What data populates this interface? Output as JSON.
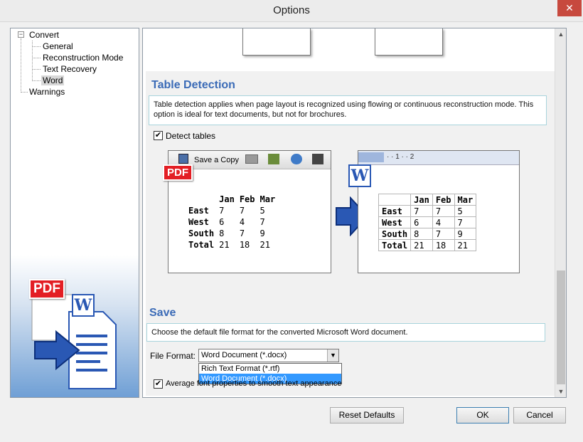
{
  "window": {
    "title": "Options",
    "close_label": "✕"
  },
  "tree": {
    "root": "Convert",
    "expander": "−",
    "children": [
      "General",
      "Reconstruction Mode",
      "Text Recovery",
      "Word"
    ],
    "other": "Warnings",
    "selected": "Word",
    "art": {
      "pdf_label": "PDF",
      "word_letter": "W"
    }
  },
  "table_detection": {
    "title": "Table Detection",
    "description": "Table detection applies when page layout is recognized using flowing or continuous reconstruction mode. This option is ideal for text documents, but not for brochures.",
    "checkbox_label": "Detect tables",
    "checked": true,
    "illustration": {
      "toolbar_text": "Save a Copy",
      "pdf_label": "PDF",
      "word_letter": "W",
      "ruler_text": "· · 1 · · 2",
      "headers": [
        "",
        "Jan",
        "Feb",
        "Mar"
      ],
      "rows": [
        [
          "East",
          "7",
          "7",
          "5"
        ],
        [
          "West",
          "6",
          "4",
          "7"
        ],
        [
          "South",
          "8",
          "7",
          "9"
        ],
        [
          "Total",
          "21",
          "18",
          "21"
        ]
      ]
    }
  },
  "save": {
    "title": "Save",
    "description": "Choose the default file format for the converted Microsoft Word document.",
    "file_format_label": "File Format:",
    "file_format_value": "Word Document (*.docx)",
    "options": [
      "Rich Text Format (*.rtf)",
      "Word Document (*.docx)"
    ],
    "selected_option": "Word Document (*.docx)",
    "avg_font_label": "Average font properties to smooth text appearance",
    "avg_font_checked": true
  },
  "buttons": {
    "reset": "Reset Defaults",
    "ok": "OK",
    "cancel": "Cancel"
  },
  "colors": {
    "accent": "#3b6bb7",
    "close": "#c7493e",
    "pdf_red": "#e31e24",
    "word_blue": "#2a58b4",
    "selection": "#3399ff"
  }
}
